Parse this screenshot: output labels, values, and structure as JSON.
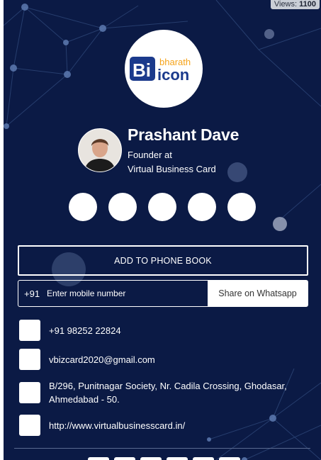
{
  "views": {
    "label": "Views:",
    "count": "1100"
  },
  "logo": {
    "text_bi": "Bi",
    "text_bharath": "bharath",
    "text_icon": "icon"
  },
  "profile": {
    "name": "Prashant Dave",
    "title_line1": "Founder at",
    "title_line2": "Virtual Business Card"
  },
  "social_icons": [
    "social-icon-1",
    "social-icon-2",
    "social-icon-3",
    "social-icon-4",
    "social-icon-5"
  ],
  "actions": {
    "add_to_phonebook": "ADD TO PHONE BOOK"
  },
  "whatsapp": {
    "country_code": "+91",
    "placeholder": "Enter mobile number",
    "button": "Share on Whatsapp"
  },
  "contacts": {
    "phone": "+91 98252 22824",
    "email": "vbizcard2020@gmail.com",
    "address": "B/296, Punitnagar Society, Nr. Cadila Crossing, Ghodasar, Ahmedabad - 50.",
    "website": "http://www.virtualbusinesscard.in/"
  },
  "colors": {
    "background": "#0b1a45",
    "logo_blue": "#1b3a8c",
    "logo_orange": "#f5a31a",
    "white": "#ffffff"
  }
}
